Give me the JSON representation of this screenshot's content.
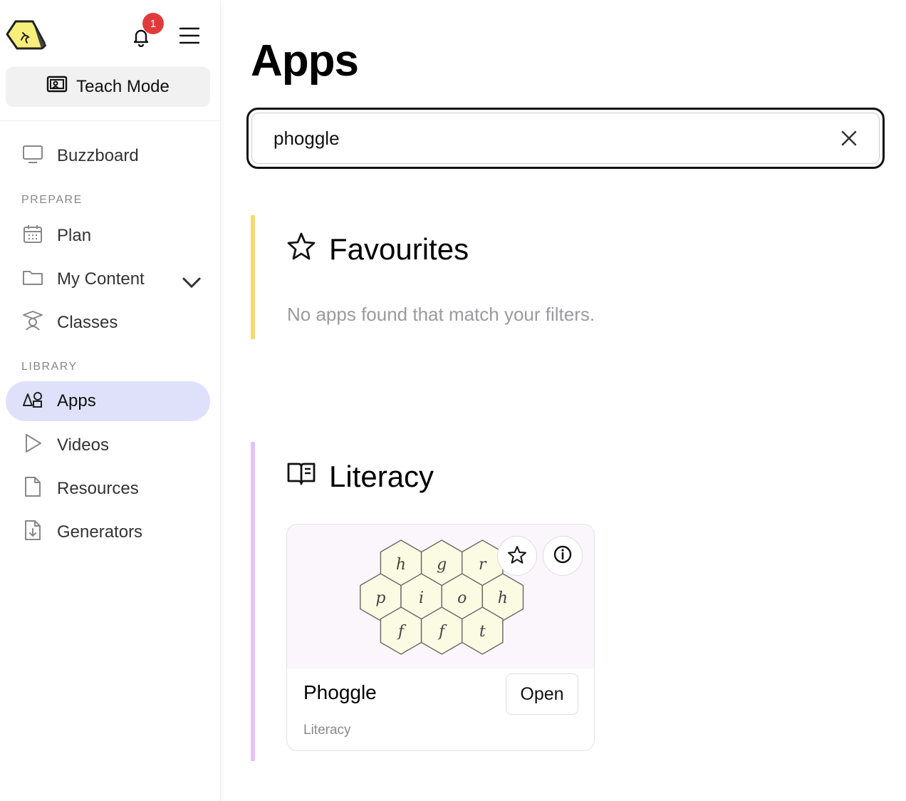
{
  "header": {
    "notification_count": "1"
  },
  "sidebar": {
    "teach_mode_label": "Teach Mode",
    "buzzboard_label": "Buzzboard",
    "prepare_label": "PREPARE",
    "library_label": "LIBRARY",
    "items": [
      {
        "label": "Plan",
        "icon": "calendar-icon"
      },
      {
        "label": "My Content",
        "icon": "folder-icon"
      },
      {
        "label": "Classes",
        "icon": "classes-icon"
      },
      {
        "label": "Apps",
        "icon": "shapes-icon",
        "active": true
      },
      {
        "label": "Videos",
        "icon": "play-icon"
      },
      {
        "label": "Resources",
        "icon": "document-icon"
      },
      {
        "label": "Generators",
        "icon": "download-document-icon"
      }
    ]
  },
  "main": {
    "title": "Apps",
    "search": {
      "value": "phoggle"
    },
    "favourites": {
      "title": "Favourites",
      "empty_message": "No apps found that match your filters.",
      "accent_color": "#f7d774"
    },
    "literacy": {
      "title": "Literacy",
      "accent_color": "#e6c3f5",
      "cards": [
        {
          "title": "Phoggle",
          "category": "Literacy",
          "open_label": "Open",
          "tile_letters": [
            "h",
            "g",
            "r",
            "p",
            "i",
            "o",
            "h",
            "f",
            "f",
            "t"
          ]
        }
      ]
    }
  },
  "colors": {
    "active_nav_bg": "#dfe1fa",
    "badge": "#e03b3b",
    "logo_yellow": "#f8ef7a"
  }
}
